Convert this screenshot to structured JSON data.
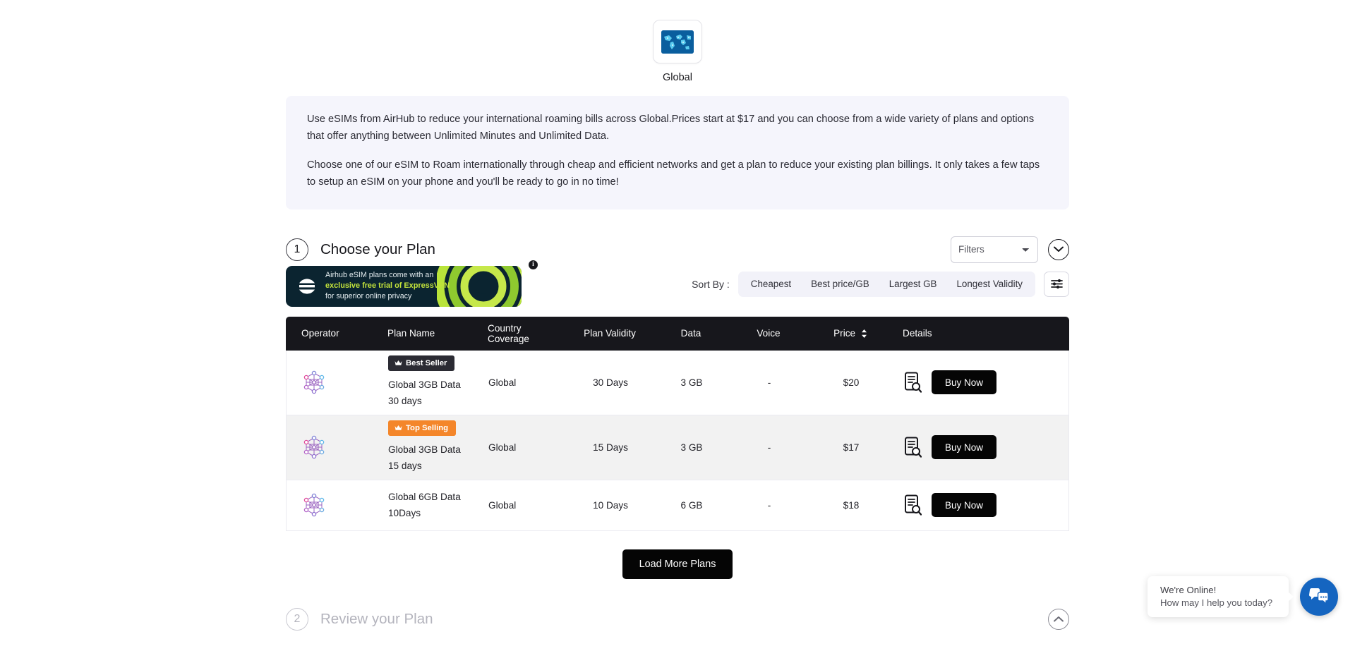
{
  "country": {
    "name": "Global",
    "flag_icon": "globe-icon"
  },
  "intro": {
    "paragraph1": "Use eSIMs from AirHub to reduce your international roaming bills across Global.Prices start at $17 and you can choose from a wide variety of plans and options that offer anything between Unlimited Minutes and Unlimited Data.",
    "paragraph2": "Choose one of our eSIM to Roam internationally through cheap and efficient networks and get a plan to reduce your existing plan billings. It only takes a few taps to setup an eSIM on your phone and you'll be ready to go in no time!"
  },
  "steps": {
    "step1": {
      "number": "1",
      "title": "Choose your Plan"
    },
    "step2": {
      "number": "2",
      "title": "Review your Plan"
    }
  },
  "filters": {
    "selected": "Filters",
    "options": [
      "Filters"
    ]
  },
  "promo": {
    "line1": "Airhub eSIM plans come with an",
    "line2": "exclusive free trial of ExpressVPN",
    "line3": "for superior online privacy",
    "info_badge": "i",
    "brand_color": "#c3e33b",
    "bg_color": "#0b2430"
  },
  "sort": {
    "label": "Sort By :",
    "options": [
      "Cheapest",
      "Best price/GB",
      "Largest GB",
      "Longest Validity"
    ]
  },
  "table": {
    "headers": {
      "operator": "Operator",
      "plan_name": "Plan Name",
      "country_coverage_line1": "Country",
      "country_coverage_line2": "Coverage",
      "plan_validity": "Plan Validity",
      "data": "Data",
      "voice": "Voice",
      "price": "Price",
      "details": "Details"
    },
    "rows": [
      {
        "badge": "Best Seller",
        "badge_type": "best",
        "plan_name_line1": "Global 3GB Data",
        "plan_name_line2": "30 days",
        "country": "Global",
        "validity": "30 Days",
        "data": "3 GB",
        "voice": "-",
        "price": "$20",
        "buy_label": "Buy Now"
      },
      {
        "badge": "Top Selling",
        "badge_type": "top",
        "plan_name_line1": "Global 3GB Data",
        "plan_name_line2": "15 days",
        "country": "Global",
        "validity": "15 Days",
        "data": "3 GB",
        "voice": "-",
        "price": "$17",
        "buy_label": "Buy Now"
      },
      {
        "badge": "",
        "badge_type": "",
        "plan_name_line1": "Global 6GB Data",
        "plan_name_line2": "10Days",
        "country": "Global",
        "validity": "10 Days",
        "data": "6 GB",
        "voice": "-",
        "price": "$18",
        "buy_label": "Buy Now"
      }
    ]
  },
  "load_more": {
    "label": "Load More Plans"
  },
  "chat": {
    "line1": "We're Online!",
    "line2": "How may I help you today?",
    "fab_color": "#1565c0",
    "fab_icon": "chat-bubbles-icon"
  }
}
